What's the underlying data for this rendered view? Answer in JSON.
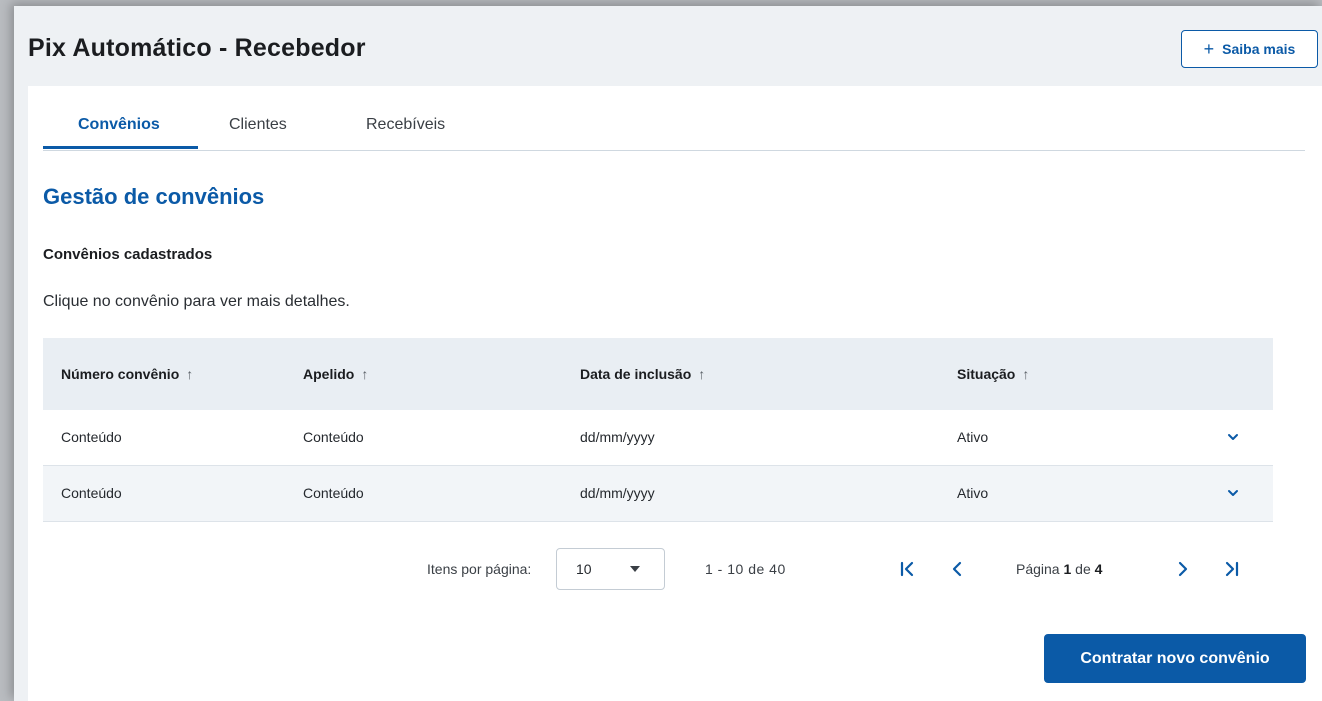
{
  "header": {
    "title": "Pix Automático - Recebedor",
    "help_button": {
      "icon": "plus-icon",
      "label": "Saiba mais"
    }
  },
  "tabs": [
    {
      "label": "Convênios",
      "active": true
    },
    {
      "label": "Clientes",
      "active": false
    },
    {
      "label": "Recebíveis",
      "active": false
    }
  ],
  "section": {
    "title": "Gestão de convênios",
    "subtitle": "Convênios cadastrados",
    "hint": "Clique no convênio para ver mais detalhes."
  },
  "table": {
    "columns": [
      {
        "label": "Número convênio",
        "sort_icon": "arrow-up-icon"
      },
      {
        "label": "Apelido",
        "sort_icon": "arrow-up-icon"
      },
      {
        "label": "Data de inclusão",
        "sort_icon": "arrow-up-icon"
      },
      {
        "label": "Situação",
        "sort_icon": "arrow-up-icon"
      }
    ],
    "rows": [
      {
        "numero": "Conteúdo",
        "apelido": "Conteúdo",
        "data": "dd/mm/yyyy",
        "situacao": "Ativo"
      },
      {
        "numero": "Conteúdo",
        "apelido": "Conteúdo",
        "data": "dd/mm/yyyy",
        "situacao": "Ativo"
      }
    ]
  },
  "pagination": {
    "items_per_page_label": "Itens por página:",
    "items_per_page_value": "10",
    "range": "1 - 10  de  40",
    "page_prefix": "Página",
    "current_page": "1",
    "page_of": "de",
    "total_pages": "4"
  },
  "actions": {
    "primary_label": "Contratar novo convênio"
  },
  "colors": {
    "brand": "#0b5aa7",
    "header_bg": "#eef1f4",
    "table_header_bg": "#e9eef3",
    "row_alt_bg": "#f2f5f8"
  }
}
